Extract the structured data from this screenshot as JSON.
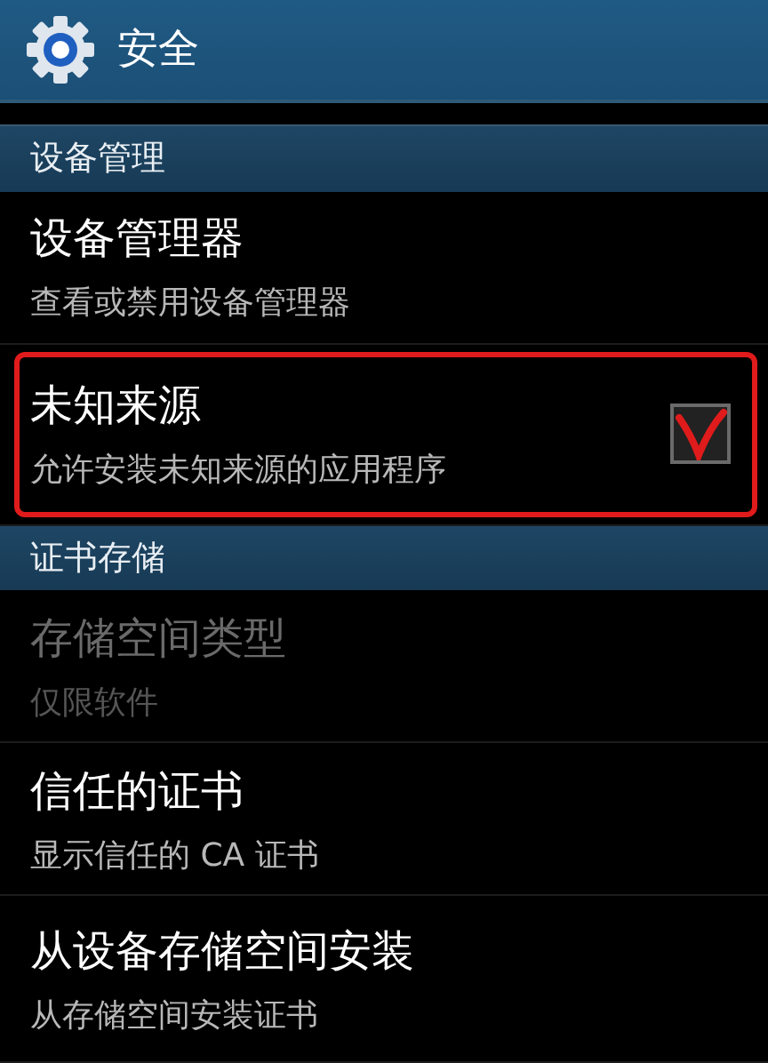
{
  "header": {
    "title": "安全"
  },
  "items": [
    {
      "kind": "section",
      "title": "设备管理"
    },
    {
      "kind": "setting",
      "title": "设备管理器",
      "summary": "查看或禁用设备管理器",
      "disabled": false
    },
    {
      "kind": "checkbox",
      "title": "未知来源",
      "summary": "允许安装未知来源的应用程序",
      "disabled": false,
      "checked": true,
      "highlighted": true
    },
    {
      "kind": "section",
      "title": "证书存储"
    },
    {
      "kind": "setting",
      "title": "存储空间类型",
      "summary": "仅限软件",
      "disabled": true
    },
    {
      "kind": "setting",
      "title": "信任的证书",
      "summary": "显示信任的 CA 证书",
      "disabled": false
    },
    {
      "kind": "setting",
      "title": "从设备存储空间安装",
      "summary": "从存储空间安装证书",
      "disabled": false
    }
  ]
}
